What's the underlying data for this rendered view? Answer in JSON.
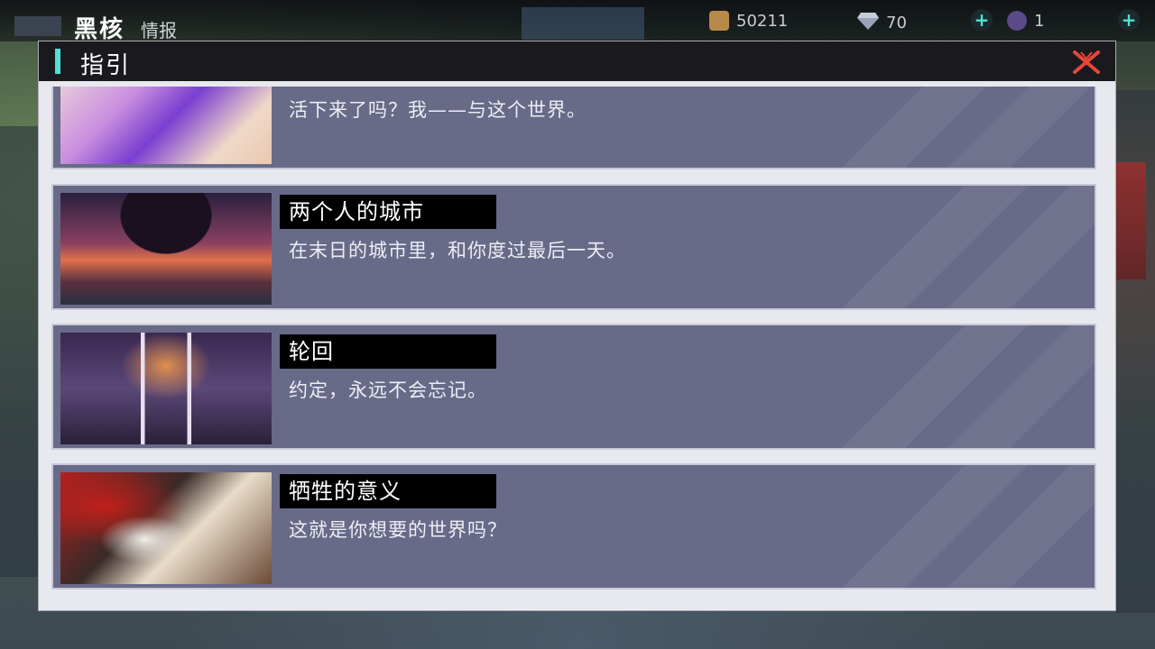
{
  "hud": {
    "title": "黑核",
    "subtitle": "情报",
    "resources": [
      {
        "name": "coin",
        "value": "50211",
        "icon": "coin-icon"
      },
      {
        "name": "diamond",
        "value": "70",
        "icon": "diamond-icon"
      },
      {
        "name": "orb",
        "value": "1",
        "icon": "orb-icon"
      }
    ]
  },
  "modal": {
    "title": "指引",
    "entries": [
      {
        "title": "",
        "desc": "活下来了吗？我——与这个世界。"
      },
      {
        "title": "两个人的城市",
        "desc": "在末日的城市里，和你度过最后一天。"
      },
      {
        "title": "轮回",
        "desc": "约定，永远不会忘记。"
      },
      {
        "title": "牺牲的意义",
        "desc": "这就是你想要的世界吗？"
      }
    ]
  },
  "colors": {
    "accent": "#52e0d8",
    "close": "#e8463a",
    "card": "#686a88",
    "header": "#1a1a1e"
  }
}
